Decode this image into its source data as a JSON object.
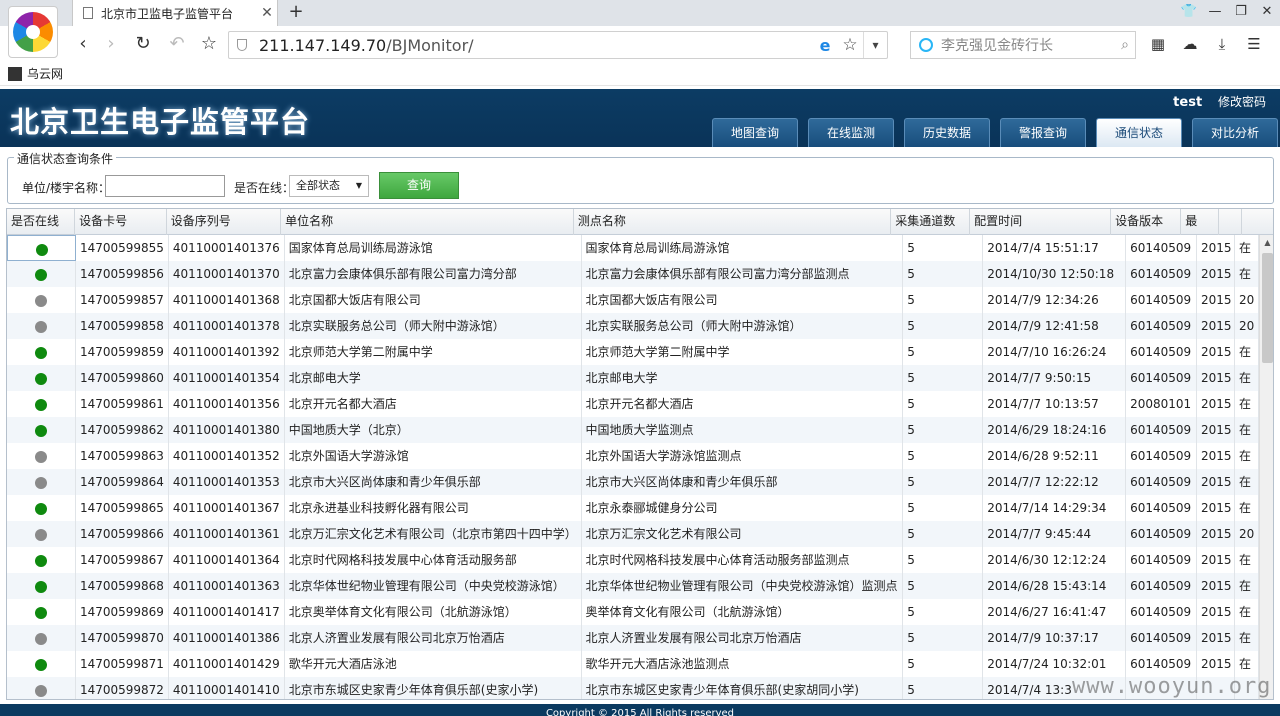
{
  "browser": {
    "tab_title": "北京市卫监电子监管平台",
    "url_host": "211.147.149.70",
    "url_path": "/BJMonitor/",
    "search_placeholder": "李克强见金砖行长",
    "bookmark_label": "乌云网"
  },
  "app": {
    "title": "北京卫生电子监管平台",
    "username": "test",
    "change_password": "修改密码",
    "nav_tabs": [
      "地图查询",
      "在线监测",
      "历史数据",
      "警报查询",
      "通信状态",
      "对比分析"
    ],
    "active_tab": "通信状态"
  },
  "query": {
    "legend": "通信状态查询条件",
    "unit_label": "单位/楼宇名称：",
    "unit_value": "",
    "online_label": "是否在线：",
    "online_selected": "全部状态",
    "search_button": "查询"
  },
  "table": {
    "columns": [
      "是否在线",
      "设备卡号",
      "设备序列号",
      "单位名称",
      "测点名称",
      "采集通道数",
      "配置时间",
      "设备版本",
      "最"
    ],
    "rows": [
      {
        "online": true,
        "card": "14700599855",
        "serial": "40110001401376",
        "unit": "国家体育总局训练局游泳馆",
        "point": "国家体育总局训练局游泳馆",
        "channels": "5",
        "config_time": "2014/7/4 15:51:17",
        "version": "60140509",
        "last": "2015",
        "extra": "在"
      },
      {
        "online": true,
        "card": "14700599856",
        "serial": "40110001401370",
        "unit": "北京富力会康体俱乐部有限公司富力湾分部",
        "point": "北京富力会康体俱乐部有限公司富力湾分部监测点",
        "channels": "5",
        "config_time": "2014/10/30 12:50:18",
        "version": "60140509",
        "last": "2015",
        "extra": "在"
      },
      {
        "online": false,
        "card": "14700599857",
        "serial": "40110001401368",
        "unit": "北京国都大饭店有限公司",
        "point": "北京国都大饭店有限公司",
        "channels": "5",
        "config_time": "2014/7/9 12:34:26",
        "version": "60140509",
        "last": "2015",
        "extra": "20"
      },
      {
        "online": false,
        "card": "14700599858",
        "serial": "40110001401378",
        "unit": "北京实联服务总公司（师大附中游泳馆）",
        "point": "北京实联服务总公司（师大附中游泳馆）",
        "channels": "5",
        "config_time": "2014/7/9 12:41:58",
        "version": "60140509",
        "last": "2015",
        "extra": "20"
      },
      {
        "online": true,
        "card": "14700599859",
        "serial": "40110001401392",
        "unit": "北京师范大学第二附属中学",
        "point": "北京师范大学第二附属中学",
        "channels": "5",
        "config_time": "2014/7/10 16:26:24",
        "version": "60140509",
        "last": "2015",
        "extra": "在"
      },
      {
        "online": true,
        "card": "14700599860",
        "serial": "40110001401354",
        "unit": "北京邮电大学",
        "point": "北京邮电大学",
        "channels": "5",
        "config_time": "2014/7/7 9:50:15",
        "version": "60140509",
        "last": "2015",
        "extra": "在"
      },
      {
        "online": true,
        "card": "14700599861",
        "serial": "40110001401356",
        "unit": "北京开元名都大酒店",
        "point": "北京开元名都大酒店",
        "channels": "5",
        "config_time": "2014/7/7 10:13:57",
        "version": "20080101",
        "last": "2015",
        "extra": "在"
      },
      {
        "online": true,
        "card": "14700599862",
        "serial": "40110001401380",
        "unit": "中国地质大学（北京）",
        "point": "中国地质大学监测点",
        "channels": "5",
        "config_time": "2014/6/29 18:24:16",
        "version": "60140509",
        "last": "2015",
        "extra": "在"
      },
      {
        "online": false,
        "card": "14700599863",
        "serial": "40110001401352",
        "unit": "北京外国语大学游泳馆",
        "point": "北京外国语大学游泳馆监测点",
        "channels": "5",
        "config_time": "2014/6/28 9:52:11",
        "version": "60140509",
        "last": "2015",
        "extra": "在"
      },
      {
        "online": false,
        "card": "14700599864",
        "serial": "40110001401353",
        "unit": "北京市大兴区尚体康和青少年俱乐部",
        "point": "北京市大兴区尚体康和青少年俱乐部",
        "channels": "5",
        "config_time": "2014/7/7 12:22:12",
        "version": "60140509",
        "last": "2015",
        "extra": "在"
      },
      {
        "online": true,
        "card": "14700599865",
        "serial": "40110001401367",
        "unit": "北京永进基业科技孵化器有限公司",
        "point": "北京永泰郦城健身分公司",
        "channels": "5",
        "config_time": "2014/7/14 14:29:34",
        "version": "60140509",
        "last": "2015",
        "extra": "在"
      },
      {
        "online": false,
        "card": "14700599866",
        "serial": "40110001401361",
        "unit": "北京万汇宗文化艺术有限公司（北京市第四十四中学）",
        "point": "北京万汇宗文化艺术有限公司",
        "channels": "5",
        "config_time": "2014/7/7 9:45:44",
        "version": "60140509",
        "last": "2015",
        "extra": "20"
      },
      {
        "online": true,
        "card": "14700599867",
        "serial": "40110001401364",
        "unit": "北京时代网格科技发展中心体育活动服务部",
        "point": "北京时代网格科技发展中心体育活动服务部监测点",
        "channels": "5",
        "config_time": "2014/6/30 12:12:24",
        "version": "60140509",
        "last": "2015",
        "extra": "在"
      },
      {
        "online": true,
        "card": "14700599868",
        "serial": "40110001401363",
        "unit": "北京华体世纪物业管理有限公司（中央党校游泳馆）",
        "point": "北京华体世纪物业管理有限公司（中央党校游泳馆）监测点",
        "channels": "5",
        "config_time": "2014/6/28 15:43:14",
        "version": "60140509",
        "last": "2015",
        "extra": "在"
      },
      {
        "online": true,
        "card": "14700599869",
        "serial": "40110001401417",
        "unit": "北京奥举体育文化有限公司（北航游泳馆）",
        "point": "奥举体育文化有限公司（北航游泳馆）",
        "channels": "5",
        "config_time": "2014/6/27 16:41:47",
        "version": "60140509",
        "last": "2015",
        "extra": "在"
      },
      {
        "online": false,
        "card": "14700599870",
        "serial": "40110001401386",
        "unit": "北京人济置业发展有限公司北京万怡酒店",
        "point": "北京人济置业发展有限公司北京万怡酒店",
        "channels": "5",
        "config_time": "2014/7/9 10:37:17",
        "version": "60140509",
        "last": "2015",
        "extra": "在"
      },
      {
        "online": true,
        "card": "14700599871",
        "serial": "40110001401429",
        "unit": "歌华开元大酒店泳池",
        "point": "歌华开元大酒店泳池监测点",
        "channels": "5",
        "config_time": "2014/7/24 10:32:01",
        "version": "60140509",
        "last": "2015",
        "extra": "在"
      },
      {
        "online": false,
        "card": "14700599872",
        "serial": "40110001401410",
        "unit": "北京市东城区史家青少年体育俱乐部(史家小学)",
        "point": "北京市东城区史家青少年体育俱乐部(史家胡同小学)",
        "channels": "5",
        "config_time": "2014/7/4 13:3",
        "version": "",
        "last": "",
        "extra": ""
      }
    ]
  },
  "footer_text": "Copyright © 2015  All Rights reserved",
  "watermark": "www.wooyun.org",
  "colors": {
    "header_bg": "#0c3c64",
    "online": "#0f8a0f",
    "offline": "#8a8a8a",
    "query_button": "#4fb84f"
  }
}
